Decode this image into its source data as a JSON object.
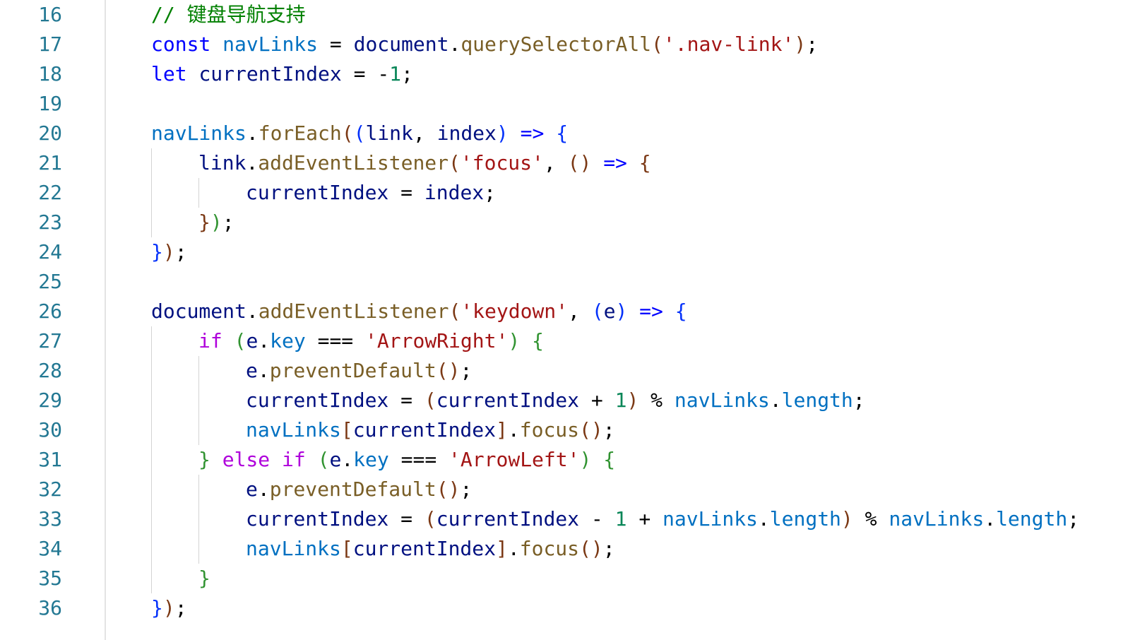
{
  "editor": {
    "language": "javascript",
    "lines": [
      {
        "number": "16",
        "indent": 0,
        "tokens": [
          {
            "t": "// 键盘导航支持",
            "c": "comment"
          }
        ]
      },
      {
        "number": "17",
        "indent": 0,
        "tokens": [
          {
            "t": "const",
            "c": "keyword"
          },
          {
            "t": " ",
            "c": "op"
          },
          {
            "t": "navLinks",
            "c": "const"
          },
          {
            "t": " = ",
            "c": "op"
          },
          {
            "t": "document",
            "c": "var"
          },
          {
            "t": ".",
            "c": "punc"
          },
          {
            "t": "querySelectorAll",
            "c": "func"
          },
          {
            "t": "(",
            "c": "b3"
          },
          {
            "t": "'.nav-link'",
            "c": "str"
          },
          {
            "t": ")",
            "c": "b3"
          },
          {
            "t": ";",
            "c": "punc"
          }
        ]
      },
      {
        "number": "18",
        "indent": 0,
        "tokens": [
          {
            "t": "let",
            "c": "keyword"
          },
          {
            "t": " ",
            "c": "op"
          },
          {
            "t": "currentIndex",
            "c": "var"
          },
          {
            "t": " = ",
            "c": "op"
          },
          {
            "t": "-",
            "c": "op"
          },
          {
            "t": "1",
            "c": "num"
          },
          {
            "t": ";",
            "c": "punc"
          }
        ]
      },
      {
        "number": "19",
        "indent": 0,
        "tokens": []
      },
      {
        "number": "20",
        "indent": 0,
        "tokens": [
          {
            "t": "navLinks",
            "c": "const"
          },
          {
            "t": ".",
            "c": "punc"
          },
          {
            "t": "forEach",
            "c": "func"
          },
          {
            "t": "(",
            "c": "b3"
          },
          {
            "t": "(",
            "c": "b1"
          },
          {
            "t": "link",
            "c": "var"
          },
          {
            "t": ", ",
            "c": "punc"
          },
          {
            "t": "index",
            "c": "var"
          },
          {
            "t": ")",
            "c": "b1"
          },
          {
            "t": " ",
            "c": "op"
          },
          {
            "t": "=>",
            "c": "keyword"
          },
          {
            "t": " ",
            "c": "op"
          },
          {
            "t": "{",
            "c": "b1"
          }
        ]
      },
      {
        "number": "21",
        "indent": 1,
        "tokens": [
          {
            "t": "link",
            "c": "var"
          },
          {
            "t": ".",
            "c": "punc"
          },
          {
            "t": "addEventListener",
            "c": "func"
          },
          {
            "t": "(",
            "c": "b3"
          },
          {
            "t": "'focus'",
            "c": "str"
          },
          {
            "t": ", ",
            "c": "punc"
          },
          {
            "t": "()",
            "c": "b3"
          },
          {
            "t": " ",
            "c": "op"
          },
          {
            "t": "=>",
            "c": "keyword"
          },
          {
            "t": " ",
            "c": "op"
          },
          {
            "t": "{",
            "c": "b3"
          }
        ]
      },
      {
        "number": "22",
        "indent": 2,
        "tokens": [
          {
            "t": "currentIndex",
            "c": "var"
          },
          {
            "t": " = ",
            "c": "op"
          },
          {
            "t": "index",
            "c": "var"
          },
          {
            "t": ";",
            "c": "punc"
          }
        ]
      },
      {
        "number": "23",
        "indent": 1,
        "tokens": [
          {
            "t": "}",
            "c": "b3"
          },
          {
            "t": ")",
            "c": "b2"
          },
          {
            "t": ";",
            "c": "punc"
          }
        ]
      },
      {
        "number": "24",
        "indent": 0,
        "tokens": [
          {
            "t": "}",
            "c": "b1"
          },
          {
            "t": ")",
            "c": "b3"
          },
          {
            "t": ";",
            "c": "punc"
          }
        ]
      },
      {
        "number": "25",
        "indent": 0,
        "tokens": []
      },
      {
        "number": "26",
        "indent": 0,
        "tokens": [
          {
            "t": "document",
            "c": "var"
          },
          {
            "t": ".",
            "c": "punc"
          },
          {
            "t": "addEventListener",
            "c": "func"
          },
          {
            "t": "(",
            "c": "b3"
          },
          {
            "t": "'keydown'",
            "c": "str"
          },
          {
            "t": ", ",
            "c": "punc"
          },
          {
            "t": "(",
            "c": "b1"
          },
          {
            "t": "e",
            "c": "var"
          },
          {
            "t": ")",
            "c": "b1"
          },
          {
            "t": " ",
            "c": "op"
          },
          {
            "t": "=>",
            "c": "keyword"
          },
          {
            "t": " ",
            "c": "op"
          },
          {
            "t": "{",
            "c": "b1"
          }
        ]
      },
      {
        "number": "27",
        "indent": 1,
        "tokens": [
          {
            "t": "if",
            "c": "control"
          },
          {
            "t": " ",
            "c": "op"
          },
          {
            "t": "(",
            "c": "b2"
          },
          {
            "t": "e",
            "c": "var"
          },
          {
            "t": ".",
            "c": "punc"
          },
          {
            "t": "key",
            "c": "const"
          },
          {
            "t": " === ",
            "c": "op"
          },
          {
            "t": "'ArrowRight'",
            "c": "str"
          },
          {
            "t": ")",
            "c": "b2"
          },
          {
            "t": " ",
            "c": "op"
          },
          {
            "t": "{",
            "c": "b2"
          }
        ]
      },
      {
        "number": "28",
        "indent": 2,
        "tokens": [
          {
            "t": "e",
            "c": "var"
          },
          {
            "t": ".",
            "c": "punc"
          },
          {
            "t": "preventDefault",
            "c": "func"
          },
          {
            "t": "()",
            "c": "b3"
          },
          {
            "t": ";",
            "c": "punc"
          }
        ]
      },
      {
        "number": "29",
        "indent": 2,
        "tokens": [
          {
            "t": "currentIndex",
            "c": "var"
          },
          {
            "t": " = ",
            "c": "op"
          },
          {
            "t": "(",
            "c": "b3"
          },
          {
            "t": "currentIndex",
            "c": "var"
          },
          {
            "t": " + ",
            "c": "op"
          },
          {
            "t": "1",
            "c": "num"
          },
          {
            "t": ")",
            "c": "b3"
          },
          {
            "t": " % ",
            "c": "op"
          },
          {
            "t": "navLinks",
            "c": "const"
          },
          {
            "t": ".",
            "c": "punc"
          },
          {
            "t": "length",
            "c": "const"
          },
          {
            "t": ";",
            "c": "punc"
          }
        ]
      },
      {
        "number": "30",
        "indent": 2,
        "tokens": [
          {
            "t": "navLinks",
            "c": "const"
          },
          {
            "t": "[",
            "c": "b3"
          },
          {
            "t": "currentIndex",
            "c": "var"
          },
          {
            "t": "]",
            "c": "b3"
          },
          {
            "t": ".",
            "c": "punc"
          },
          {
            "t": "focus",
            "c": "func"
          },
          {
            "t": "()",
            "c": "b3"
          },
          {
            "t": ";",
            "c": "punc"
          }
        ]
      },
      {
        "number": "31",
        "indent": 1,
        "tokens": [
          {
            "t": "}",
            "c": "b2"
          },
          {
            "t": " ",
            "c": "op"
          },
          {
            "t": "else",
            "c": "control"
          },
          {
            "t": " ",
            "c": "op"
          },
          {
            "t": "if",
            "c": "control"
          },
          {
            "t": " ",
            "c": "op"
          },
          {
            "t": "(",
            "c": "b2"
          },
          {
            "t": "e",
            "c": "var"
          },
          {
            "t": ".",
            "c": "punc"
          },
          {
            "t": "key",
            "c": "const"
          },
          {
            "t": " === ",
            "c": "op"
          },
          {
            "t": "'ArrowLeft'",
            "c": "str"
          },
          {
            "t": ")",
            "c": "b2"
          },
          {
            "t": " ",
            "c": "op"
          },
          {
            "t": "{",
            "c": "b2"
          }
        ]
      },
      {
        "number": "32",
        "indent": 2,
        "tokens": [
          {
            "t": "e",
            "c": "var"
          },
          {
            "t": ".",
            "c": "punc"
          },
          {
            "t": "preventDefault",
            "c": "func"
          },
          {
            "t": "()",
            "c": "b3"
          },
          {
            "t": ";",
            "c": "punc"
          }
        ]
      },
      {
        "number": "33",
        "indent": 2,
        "tokens": [
          {
            "t": "currentIndex",
            "c": "var"
          },
          {
            "t": " = ",
            "c": "op"
          },
          {
            "t": "(",
            "c": "b3"
          },
          {
            "t": "currentIndex",
            "c": "var"
          },
          {
            "t": " - ",
            "c": "op"
          },
          {
            "t": "1",
            "c": "num"
          },
          {
            "t": " + ",
            "c": "op"
          },
          {
            "t": "navLinks",
            "c": "const"
          },
          {
            "t": ".",
            "c": "punc"
          },
          {
            "t": "length",
            "c": "const"
          },
          {
            "t": ")",
            "c": "b3"
          },
          {
            "t": " % ",
            "c": "op"
          },
          {
            "t": "navLinks",
            "c": "const"
          },
          {
            "t": ".",
            "c": "punc"
          },
          {
            "t": "length",
            "c": "const"
          },
          {
            "t": ";",
            "c": "punc"
          }
        ]
      },
      {
        "number": "34",
        "indent": 2,
        "tokens": [
          {
            "t": "navLinks",
            "c": "const"
          },
          {
            "t": "[",
            "c": "b3"
          },
          {
            "t": "currentIndex",
            "c": "var"
          },
          {
            "t": "]",
            "c": "b3"
          },
          {
            "t": ".",
            "c": "punc"
          },
          {
            "t": "focus",
            "c": "func"
          },
          {
            "t": "()",
            "c": "b3"
          },
          {
            "t": ";",
            "c": "punc"
          }
        ]
      },
      {
        "number": "35",
        "indent": 1,
        "tokens": [
          {
            "t": "}",
            "c": "b2"
          }
        ]
      },
      {
        "number": "36",
        "indent": 0,
        "tokens": [
          {
            "t": "}",
            "c": "b1"
          },
          {
            "t": ")",
            "c": "b3"
          },
          {
            "t": ";",
            "c": "punc"
          }
        ]
      }
    ],
    "indent_guides": [
      {
        "column": 0,
        "from_line": "21",
        "to_line": "23"
      },
      {
        "column": 1,
        "from_line": "22",
        "to_line": "22"
      },
      {
        "column": 0,
        "from_line": "27",
        "to_line": "35"
      },
      {
        "column": 1,
        "from_line": "28",
        "to_line": "30"
      },
      {
        "column": 1,
        "from_line": "32",
        "to_line": "34"
      }
    ]
  }
}
